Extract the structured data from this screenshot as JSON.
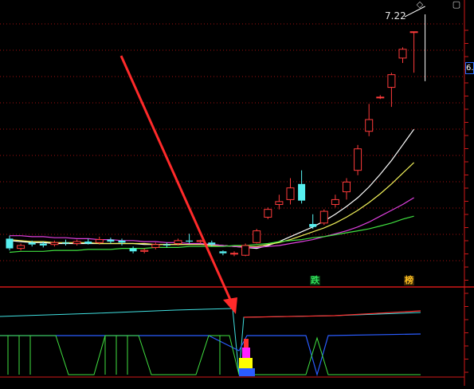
{
  "colors": {
    "background": "#000000",
    "grid": "#a01010",
    "divider": "#d01818",
    "up_candle": "#ff3b3b",
    "down_candle": "#57f0f0",
    "ma_white": "#ffffff",
    "ma_yellow": "#f2f25a",
    "ma_magenta": "#e040e0",
    "ma_green": "#40e040",
    "arrow": "#ff2a2a",
    "ind_cyan": "#40e0e0",
    "ind_red": "#ff3030",
    "ind_blue": "#2a5cff",
    "ind_green": "#40e040"
  },
  "toolbar": {
    "diamond_icon": "diamond-icon",
    "square_icon": "square-icon"
  },
  "price_panel": {
    "high_label": "7.22",
    "right_price_tag": "6."
  },
  "signals": {
    "die_label": "跌",
    "bang_label": "榜"
  },
  "chart_data": {
    "type": "candlestick",
    "title": "",
    "candles": [
      {
        "o": 5.1,
        "c": 5.0,
        "h": 5.13,
        "l": 4.98
      },
      {
        "o": 5.0,
        "c": 5.03,
        "h": 5.05,
        "l": 4.98
      },
      {
        "o": 5.06,
        "c": 5.04,
        "h": 5.08,
        "l": 5.02
      },
      {
        "o": 5.05,
        "c": 5.03,
        "h": 5.07,
        "l": 5.01
      },
      {
        "o": 5.04,
        "c": 5.06,
        "h": 5.08,
        "l": 5.02
      },
      {
        "o": 5.06,
        "c": 5.05,
        "h": 5.09,
        "l": 5.03
      },
      {
        "o": 5.05,
        "c": 5.07,
        "h": 5.09,
        "l": 5.03
      },
      {
        "o": 5.07,
        "c": 5.05,
        "h": 5.1,
        "l": 5.04
      },
      {
        "o": 5.06,
        "c": 5.09,
        "h": 5.12,
        "l": 5.04
      },
      {
        "o": 5.09,
        "c": 5.07,
        "h": 5.11,
        "l": 5.05
      },
      {
        "o": 5.08,
        "c": 5.06,
        "h": 5.1,
        "l": 5.03
      },
      {
        "o": 5.0,
        "c": 4.97,
        "h": 5.02,
        "l": 4.95
      },
      {
        "o": 4.97,
        "c": 4.98,
        "h": 5.0,
        "l": 4.95
      },
      {
        "o": 5.01,
        "c": 5.04,
        "h": 5.06,
        "l": 4.99
      },
      {
        "o": 5.04,
        "c": 5.03,
        "h": 5.06,
        "l": 5.01
      },
      {
        "o": 5.05,
        "c": 5.08,
        "h": 5.1,
        "l": 5.03
      },
      {
        "o": 5.08,
        "c": 5.07,
        "h": 5.15,
        "l": 5.05
      },
      {
        "o": 5.07,
        "c": 5.08,
        "h": 5.09,
        "l": 5.05
      },
      {
        "o": 5.06,
        "c": 5.04,
        "h": 5.08,
        "l": 5.02
      },
      {
        "o": 4.97,
        "c": 4.95,
        "h": 4.98,
        "l": 4.93
      },
      {
        "o": 4.95,
        "c": 4.95,
        "h": 4.97,
        "l": 4.92
      },
      {
        "o": 4.93,
        "c": 5.03,
        "h": 5.05,
        "l": 4.92
      },
      {
        "o": 5.06,
        "c": 5.18,
        "h": 5.2,
        "l": 5.05
      },
      {
        "o": 5.32,
        "c": 5.4,
        "h": 5.42,
        "l": 5.3
      },
      {
        "o": 5.45,
        "c": 5.48,
        "h": 5.55,
        "l": 5.4
      },
      {
        "o": 5.5,
        "c": 5.62,
        "h": 5.72,
        "l": 5.45
      },
      {
        "o": 5.66,
        "c": 5.49,
        "h": 5.8,
        "l": 5.46
      },
      {
        "o": 5.25,
        "c": 5.22,
        "h": 5.35,
        "l": 5.2
      },
      {
        "o": 5.26,
        "c": 5.38,
        "h": 5.4,
        "l": 5.24
      },
      {
        "o": 5.45,
        "c": 5.5,
        "h": 5.55,
        "l": 5.42
      },
      {
        "o": 5.58,
        "c": 5.68,
        "h": 5.72,
        "l": 5.5
      },
      {
        "o": 5.8,
        "c": 6.02,
        "h": 6.06,
        "l": 5.75
      },
      {
        "o": 6.2,
        "c": 6.32,
        "h": 6.48,
        "l": 6.15
      },
      {
        "o": 6.55,
        "c": 6.55,
        "h": 6.57,
        "l": 6.53
      },
      {
        "o": 6.65,
        "c": 6.78,
        "h": 6.8,
        "l": 6.45
      },
      {
        "o": 6.95,
        "c": 7.04,
        "h": 7.06,
        "l": 6.9
      },
      {
        "o": 7.22,
        "c": 7.22,
        "h": 7.22,
        "l": 6.8
      }
    ],
    "moving_averages": [
      {
        "color_key": "ma_white",
        "values": [
          5.08,
          5.07,
          5.06,
          5.06,
          5.05,
          5.05,
          5.05,
          5.05,
          5.05,
          5.05,
          5.05,
          5.05,
          5.04,
          5.04,
          5.04,
          5.04,
          5.04,
          5.04,
          5.04,
          5.03,
          5.02,
          5.01,
          5.0,
          5.03,
          5.07,
          5.12,
          5.17,
          5.22,
          5.28,
          5.35,
          5.43,
          5.52,
          5.63,
          5.76,
          5.9,
          6.06,
          6.22
        ]
      },
      {
        "color_key": "ma_yellow",
        "values": [
          5.09,
          5.08,
          5.07,
          5.07,
          5.06,
          5.06,
          5.06,
          5.06,
          5.05,
          5.05,
          5.05,
          5.05,
          5.05,
          5.04,
          5.04,
          5.04,
          5.04,
          5.04,
          5.03,
          5.03,
          5.02,
          5.02,
          5.02,
          5.04,
          5.06,
          5.09,
          5.13,
          5.17,
          5.21,
          5.26,
          5.32,
          5.39,
          5.47,
          5.56,
          5.66,
          5.77,
          5.88
        ]
      },
      {
        "color_key": "ma_magenta",
        "values": [
          5.13,
          5.13,
          5.12,
          5.12,
          5.11,
          5.11,
          5.1,
          5.1,
          5.09,
          5.09,
          5.08,
          5.08,
          5.07,
          5.07,
          5.06,
          5.06,
          5.05,
          5.05,
          5.04,
          5.03,
          5.02,
          5.01,
          5.01,
          5.02,
          5.03,
          5.05,
          5.07,
          5.09,
          5.12,
          5.15,
          5.18,
          5.22,
          5.27,
          5.33,
          5.39,
          5.45,
          5.52
        ]
      },
      {
        "color_key": "ma_green",
        "values": [
          4.96,
          4.97,
          4.97,
          4.97,
          4.98,
          4.98,
          4.98,
          4.99,
          4.99,
          4.99,
          5.0,
          5.0,
          5.0,
          5.01,
          5.01,
          5.01,
          5.02,
          5.02,
          5.02,
          5.02,
          5.03,
          5.03,
          5.04,
          5.05,
          5.07,
          5.08,
          5.09,
          5.11,
          5.12,
          5.14,
          5.16,
          5.18,
          5.2,
          5.23,
          5.26,
          5.3,
          5.33
        ]
      }
    ]
  }
}
